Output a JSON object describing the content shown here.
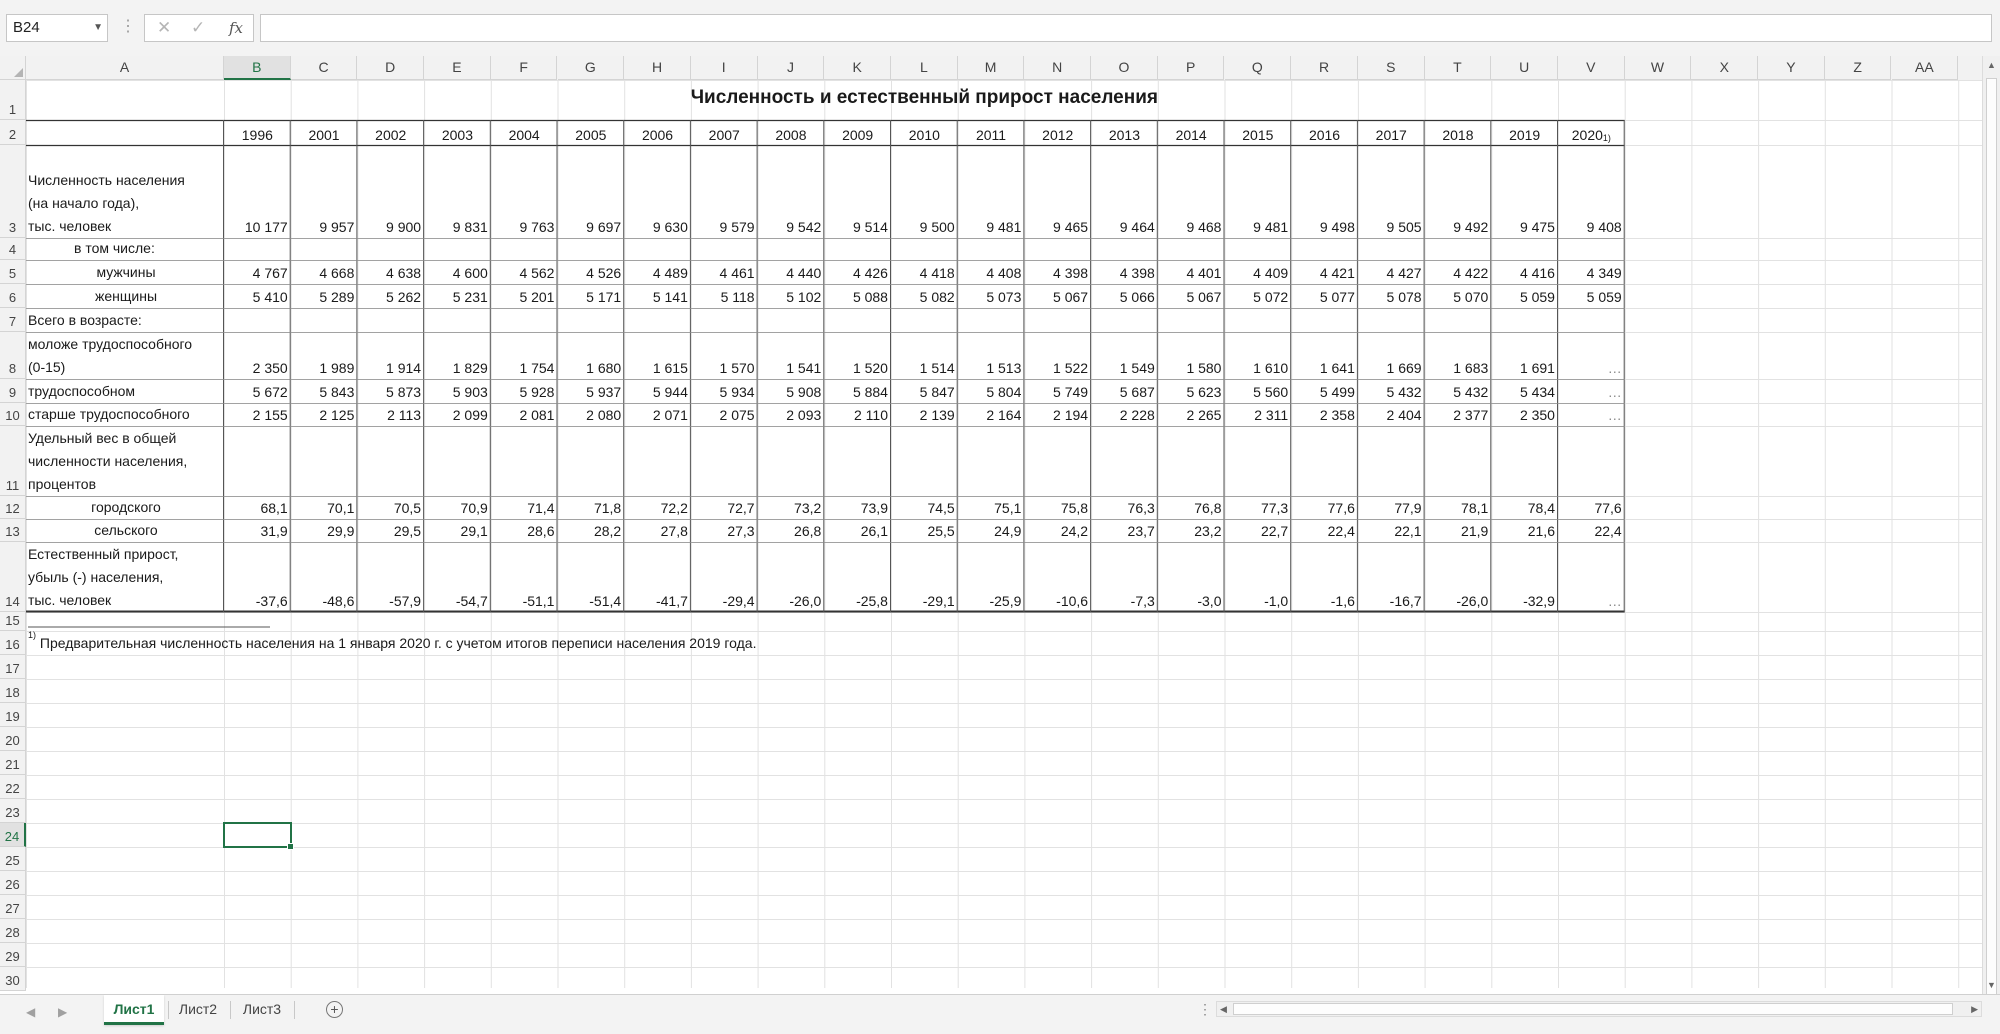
{
  "formula_bar": {
    "name_box": "B24",
    "cancel_icon": "✕",
    "enter_icon": "✓",
    "function_icon": "fx",
    "formula_value": ""
  },
  "columns": [
    "A",
    "B",
    "C",
    "D",
    "E",
    "F",
    "G",
    "H",
    "I",
    "J",
    "K",
    "L",
    "M",
    "N",
    "O",
    "P",
    "Q",
    "R",
    "S",
    "T",
    "U",
    "V",
    "W",
    "X",
    "Y",
    "Z",
    "AA"
  ],
  "rows": [
    "1",
    "2",
    "3",
    "4",
    "5",
    "6",
    "7",
    "8",
    "9",
    "10",
    "11",
    "12",
    "13",
    "14",
    "15",
    "16",
    "17",
    "18",
    "19",
    "20",
    "21",
    "22",
    "23",
    "24",
    "25",
    "26",
    "27",
    "28",
    "29",
    "30"
  ],
  "selected_cell": {
    "column": "B",
    "row": "24"
  },
  "sheet": {
    "title": "Численность и естественный прирост населения",
    "years": [
      "1996",
      "2001",
      "2002",
      "2003",
      "2004",
      "2005",
      "2006",
      "2007",
      "2008",
      "2009",
      "2010",
      "2011",
      "2012",
      "2013",
      "2014",
      "2015",
      "2016",
      "2017",
      "2018",
      "2019",
      "2020"
    ],
    "last_year_footnote_mark": "1)",
    "table_rows": [
      {
        "label_lines": [
          "Численность населения",
          "(на начало года),",
          "тыс. человек"
        ],
        "indent": false,
        "values": [
          "10 177",
          "9 957",
          "9 900",
          "9 831",
          "9 763",
          "9 697",
          "9 630",
          "9 579",
          "9 542",
          "9 514",
          "9 500",
          "9 481",
          "9 465",
          "9 464",
          "9 468",
          "9 481",
          "9 498",
          "9 505",
          "9 492",
          "9 475",
          "9 408"
        ]
      },
      {
        "label_lines": [
          "в том числе:"
        ],
        "indent": "sub",
        "values": []
      },
      {
        "label_lines": [
          "мужчины"
        ],
        "indent": "center",
        "values": [
          "4 767",
          "4 668",
          "4 638",
          "4 600",
          "4 562",
          "4 526",
          "4 489",
          "4 461",
          "4 440",
          "4 426",
          "4 418",
          "4 408",
          "4 398",
          "4 398",
          "4 401",
          "4 409",
          "4 421",
          "4 427",
          "4 422",
          "4 416",
          "4 349"
        ]
      },
      {
        "label_lines": [
          "женщины"
        ],
        "indent": "center",
        "values": [
          "5 410",
          "5 289",
          "5 262",
          "5 231",
          "5 201",
          "5 171",
          "5 141",
          "5 118",
          "5 102",
          "5 088",
          "5 082",
          "5 073",
          "5 067",
          "5 066",
          "5 067",
          "5 072",
          "5 077",
          "5 078",
          "5 070",
          "5 059",
          "5 059"
        ]
      },
      {
        "label_lines": [
          "Всего  в возрасте:"
        ],
        "indent": false,
        "values": []
      },
      {
        "label_lines": [
          "моложе трудоспособного",
          "(0-15)"
        ],
        "indent": false,
        "values": [
          "2 350",
          "1 989",
          "1 914",
          "1 829",
          "1 754",
          "1 680",
          "1 615",
          "1 570",
          "1 541",
          "1 520",
          "1 514",
          "1 513",
          "1 522",
          "1 549",
          "1 580",
          "1 610",
          "1 641",
          "1 669",
          "1 683",
          "1 691",
          "…"
        ]
      },
      {
        "label_lines": [
          "трудоспособном"
        ],
        "indent": false,
        "values": [
          "5 672",
          "5 843",
          "5 873",
          "5 903",
          "5 928",
          "5 937",
          "5 944",
          "5 934",
          "5 908",
          "5 884",
          "5 847",
          "5 804",
          "5 749",
          "5 687",
          "5 623",
          "5 560",
          "5 499",
          "5 432",
          "5 432",
          "5 434",
          "…"
        ]
      },
      {
        "label_lines": [
          "старше трудоспособного"
        ],
        "indent": false,
        "values": [
          "2 155",
          "2 125",
          "2 113",
          "2 099",
          "2 081",
          "2 080",
          "2 071",
          "2 075",
          "2 093",
          "2 110",
          "2 139",
          "2 164",
          "2 194",
          "2 228",
          "2 265",
          "2 311",
          "2 358",
          "2 404",
          "2 377",
          "2 350",
          "…"
        ]
      },
      {
        "label_lines": [
          "Удельный вес в общей",
          "численности населения,",
          "процентов"
        ],
        "indent": false,
        "values": []
      },
      {
        "label_lines": [
          "городского"
        ],
        "indent": "center",
        "values": [
          "68,1",
          "70,1",
          "70,5",
          "70,9",
          "71,4",
          "71,8",
          "72,2",
          "72,7",
          "73,2",
          "73,9",
          "74,5",
          "75,1",
          "75,8",
          "76,3",
          "76,8",
          "77,3",
          "77,6",
          "77,9",
          "78,1",
          "78,4",
          "77,6"
        ]
      },
      {
        "label_lines": [
          "сельского"
        ],
        "indent": "center",
        "values": [
          "31,9",
          "29,9",
          "29,5",
          "29,1",
          "28,6",
          "28,2",
          "27,8",
          "27,3",
          "26,8",
          "26,1",
          "25,5",
          "24,9",
          "24,2",
          "23,7",
          "23,2",
          "22,7",
          "22,4",
          "22,1",
          "21,9",
          "21,6",
          "22,4"
        ]
      },
      {
        "label_lines": [
          "Естественный прирост,",
          "убыль (-) населения,",
          "тыс. человек"
        ],
        "indent": false,
        "values": [
          "-37,6",
          "-48,6",
          "-57,9",
          "-54,7",
          "-51,1",
          "-51,4",
          "-41,7",
          "-29,4",
          "-26,0",
          "-25,8",
          "-29,1",
          "-25,9",
          "-10,6",
          "-7,3",
          "-3,0",
          "-1,0",
          "-1,6",
          "-16,7",
          "-26,0",
          "-32,9",
          "…"
        ]
      }
    ],
    "footnote_mark": "1)",
    "footnote": " Предварительная численность населения на 1 января 2020 г. с учетом итогов переписи населения 2019 года."
  },
  "sheet_tabs": [
    "Лист1",
    "Лист2",
    "Лист3"
  ],
  "active_tab": "Лист1",
  "add_sheet_icon": "+",
  "colors": {
    "accent": "#217346",
    "grid": "#d4d4d4",
    "header_bg": "#f2f2f2"
  }
}
